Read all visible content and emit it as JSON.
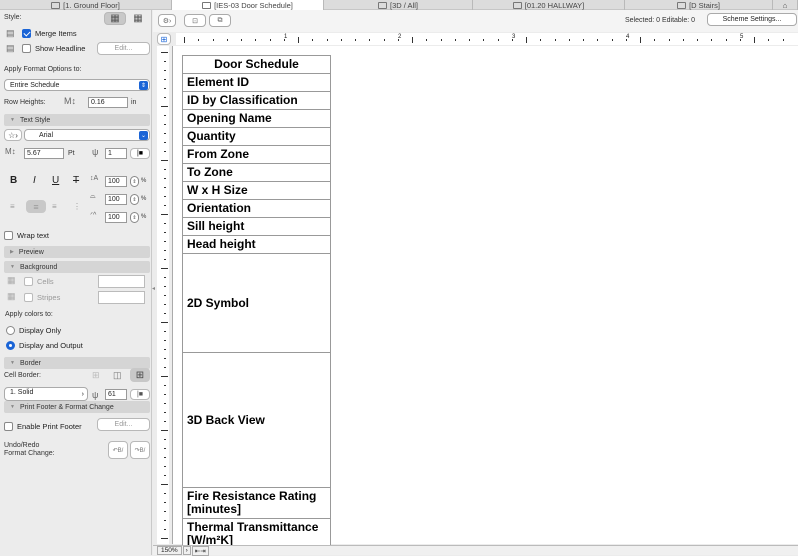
{
  "tabs": [
    {
      "label": "[1. Ground Floor]",
      "icon": "floor-plan-icon",
      "active": false
    },
    {
      "label": "[IES-03 Door Schedule]",
      "icon": "schedule-icon",
      "active": true
    },
    {
      "label": "[3D / All]",
      "icon": "3d-icon",
      "active": false
    },
    {
      "label": "[01.20 HALLWAY]",
      "icon": "section-icon",
      "active": false
    },
    {
      "label": "[D Stairs]",
      "icon": "detail-icon",
      "active": false
    }
  ],
  "sidebar": {
    "style_label": "Style:",
    "merge_items": {
      "label": "Merge Items",
      "checked": true
    },
    "show_headline": {
      "label": "Show Headline",
      "checked": false
    },
    "edit_label": "Edit...",
    "apply_format_label": "Apply Format Options to:",
    "apply_format_value": "Entire Schedule",
    "row_heights_label": "Row Heights:",
    "row_heights_value": "0.16",
    "row_heights_unit": "in",
    "text_style_section": "Text Style",
    "font_value": "Arial",
    "font_size_value": "5.67",
    "font_size_unit": "Pt",
    "pen_value": "1",
    "bold": "B",
    "italic": "I",
    "underline": "U",
    "strike": "T",
    "scale1": "100",
    "scale2": "100",
    "scale3": "100",
    "percent": "%",
    "wrap_text": {
      "label": "Wrap text",
      "checked": false
    },
    "preview_section": "Preview",
    "background_section": "Background",
    "cells_label": "Cells",
    "stripes_label": "Stripes",
    "apply_colors_label": "Apply colors to:",
    "display_only": "Display Only",
    "display_output": "Display and Output",
    "border_section": "Border",
    "cell_border_label": "Cell Border:",
    "line_type": "1. Solid",
    "border_pen": "61",
    "print_footer_section": "Print Footer & Format Change",
    "enable_print_footer": {
      "label": "Enable Print Footer",
      "checked": false
    },
    "footer_edit": "Edit...",
    "undo_redo_label": "Undo/Redo",
    "format_change_label": "Format Change:"
  },
  "header": {
    "selected_text": "Selected: 0  Editable: 0",
    "scheme_settings": "Scheme Settings..."
  },
  "ruler": {
    "labels": [
      "1",
      "2",
      "3",
      "4",
      "5"
    ]
  },
  "schedule": {
    "title": "Door Schedule",
    "rows": [
      "Element ID",
      "ID by Classification",
      "Opening Name",
      "Quantity",
      "From Zone",
      "To Zone",
      "W x H Size",
      "Orientation",
      "Sill height",
      "Head height",
      "2D Symbol",
      "3D Back View",
      "Fire Resistance Rating [minutes]",
      "Thermal Transmittance [W/m²K]"
    ]
  },
  "footer": {
    "zoom": "150%"
  }
}
